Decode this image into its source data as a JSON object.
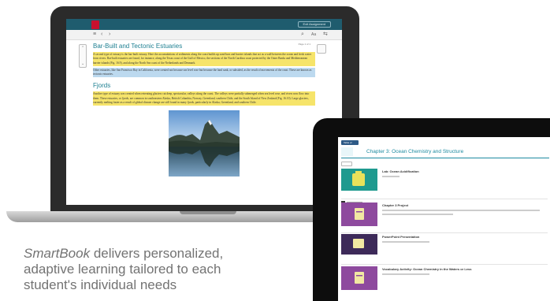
{
  "laptop": {
    "app": {
      "assignment_button": "Exit Assignment",
      "page_indicator": "Page 1 of 1",
      "toolbar_glyphs": {
        "menu": "≡",
        "prev": "‹",
        "next": "›",
        "search": "⌕",
        "text_size": "Aa",
        "settings": "⇆"
      }
    },
    "reading": {
      "section1_title": "Bar-Built and Tectonic Estuaries",
      "section1_para": "A second type of estuary is the bar-built estuary. Here the accumulations of sediments along the coast builds up sand bars and barrier islands that act as a wall between the ocean and fresh water from rivers. Bar-built estuaries are found, for instance, along the Texas coast of the Gulf of Mexico, the sections of the North Carolina coast protected by the Outer Banks and Mediterranean barrier islands (Fig. 16.9), and along the North Sea coast of the Netherlands and Denmark.",
      "section1_para2": "Other estuaries, like San Francisco Bay in California, were created not because sea level rose but because the land sank, or subsided, as the result of movements of the crust. These are known as tectonic estuaries.",
      "section2_title": "Fjords",
      "section2_para": "Another type of estuary was created when retreating glaciers cut deep, spectacular, valleys along the coast. The valleys were partially submerged when sea level rose, and rivers now flow into them. These estuaries, or fjords, are common in southeastern Alaska, British Columbia, Norway, Greenland, southern Chile, and the South Island of New Zealand (Fig. 16.10). Large glaciers, currently melting faster as a result of global climate change are still found in many fjords, particularly in Alaska, Greenland, and southern Chile."
    }
  },
  "tablet": {
    "header_button": "Table of Contents",
    "chapter_title": "Chapter 3: Ocean Chemistry and Structure",
    "items": [
      {
        "title": "Lab: Ocean Acidification"
      },
      {
        "title": "Chapter 3 Project"
      },
      {
        "title": "PowerPoint Presentation"
      },
      {
        "title": "Vocabulary Activity: Ocean Chemistry in the Waters or Less"
      }
    ]
  },
  "caption": {
    "brand": "SmartBook",
    "text": " delivers personalized,\nadaptive learning tailored to each\nstudent's individual needs"
  }
}
